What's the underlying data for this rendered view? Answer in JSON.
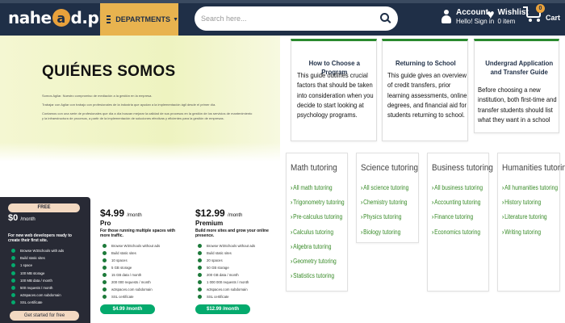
{
  "header": {
    "logo_a": "nahe",
    "logo_o": "a",
    "logo_b": "d.pk",
    "departments_label": "DEPARTMENTS",
    "search_placeholder": "Search here...",
    "account_title": "Account",
    "account_sub": "Hello! Sign in",
    "wishlist_title": "Wishlist",
    "wishlist_sub": "0 item",
    "cart_count": "0",
    "cart_label": "Cart"
  },
  "hero": {
    "title": "QUIÉNES SOMOS",
    "para1": "Somos Agilar. Nuestro compromiso de mediación a la gestión en la empresa.",
    "para2": "Contamos con una serie de profesionales que día a día buscan mejorar la calidad de sus procesos en la gestión de los servicios de mantenimiento y la infraestructura de procesos, a partir de la implementación de soluciones efectivas y eficientes para la gestión de empresas.",
    "footer_line": "Trabajar con Agilar con trabajo con profesionales de la industria que ayudan a la implementación ágil desde el primer día."
  },
  "pricing": {
    "free": {
      "badge": "FREE",
      "price": "$0",
      "per": "/month",
      "desc": "For new web developers ready to create their first site.",
      "features": [
        "Browse W3Schools with ads",
        "Build static sites",
        "1 space",
        "100 MB storage",
        "100 MB data / month",
        "500 requests / month",
        "w3spaces.com subdomain",
        "SSL certificate"
      ],
      "cta": "Get started for free"
    },
    "pro": {
      "price": "$4.99",
      "per": "/month",
      "name": "Pro",
      "desc": "For those running multiple spaces with more traffic.",
      "features": [
        "Browse W3Schools without ads",
        "Build static sites",
        "10 spaces",
        "5 GB storage",
        "15 GB data / month",
        "200 000 requests / month",
        "w3spaces.com subdomain",
        "SSL certificate"
      ],
      "cta": "$4.99 /month"
    },
    "premium": {
      "price": "$12.99",
      "per": "/month",
      "name": "Premium",
      "desc": "Build more sites and grow your online presence.",
      "features": [
        "Browse W3Schools without ads",
        "Build static sites",
        "20 spaces",
        "50 GB storage",
        "200 GB data / month",
        "1 000 000 requests / month",
        "w3spaces.com subdomain",
        "SSL certificate"
      ],
      "cta": "$12.99 /month"
    }
  },
  "guides": [
    {
      "title": "How to Choose a Program",
      "body": "This guide outlines crucial factors that should be taken into consideration when you decide to start looking at psychology programs."
    },
    {
      "title": "Returning to School",
      "body": "This guide gives an overview of credit transfers, prior learning assessments, online degrees, and financial aid for students returning to school."
    },
    {
      "title": "Undergrad Application and Transfer Guide",
      "body": "Before choosing a new institution, both first-time and transfer students should list what they want in a school"
    }
  ],
  "tutoring": [
    {
      "title": "Math tutoring",
      "links": [
        "All math tutoring",
        "Trigonometry tutoring",
        "Pre-calculus tutoring",
        "Calculus tutoring",
        "Algebra tutoring",
        "Geometry tutoring",
        "Statistics tutoring"
      ]
    },
    {
      "title": "Science tutoring",
      "links": [
        "All science tutoring",
        "Chemistry tutoring",
        "Physics tutoring",
        "Biology tutoring"
      ]
    },
    {
      "title": "Business tutoring",
      "links": [
        "All business tutoring",
        "Accounting tutoring",
        "Finance tutoring",
        "Economics tutoring"
      ]
    },
    {
      "title": "Humanities tutoring",
      "links": [
        "All humanities tutoring",
        "History tutoring",
        "Literature tutoring",
        "Writing tutoring"
      ]
    }
  ],
  "colors": {
    "header_bg": "#1f2f47",
    "accent": "#e8b34f",
    "link_green": "#3a8c2a",
    "card_top": "#2a8a2e"
  }
}
